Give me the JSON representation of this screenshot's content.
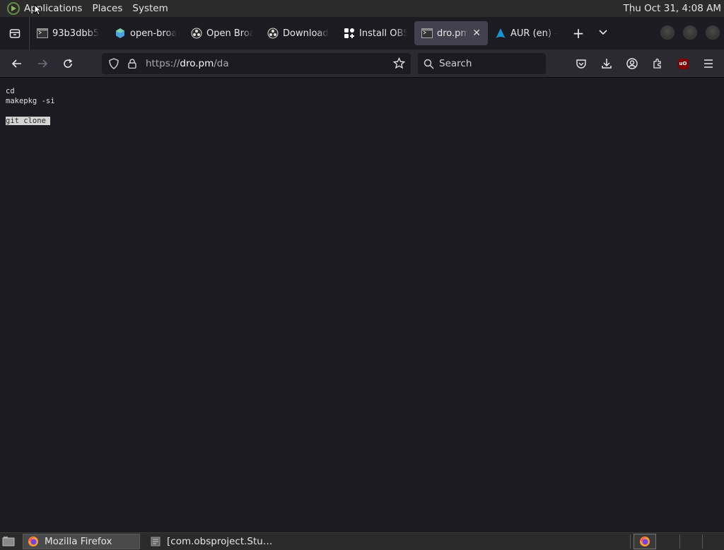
{
  "top_panel": {
    "menus": [
      "Applications",
      "Places",
      "System"
    ],
    "clock": "Thu Oct 31,  4:08 AM"
  },
  "tabs": [
    {
      "title": "93b3dbb5",
      "icon": "terminal-favicon",
      "active": false
    },
    {
      "title": "open-broa",
      "icon": "flathub-favicon",
      "active": false
    },
    {
      "title": "Open Broa",
      "icon": "obs-favicon",
      "active": false
    },
    {
      "title": "Download",
      "icon": "obs-favicon",
      "active": false
    },
    {
      "title": "Install OBS",
      "icon": "flathub-favicon",
      "active": false
    },
    {
      "title": "dro.pm/d",
      "icon": "terminal-favicon",
      "active": true
    },
    {
      "title": "AUR (en) -",
      "icon": "arch-favicon",
      "active": false
    }
  ],
  "navbar": {
    "url_protocol": "https://",
    "url_host": "dro.pm",
    "url_path": "/da",
    "search_placeholder": "Search"
  },
  "content": {
    "lines": [
      "cd",
      "makepkg -si",
      "",
      "git clone"
    ],
    "selected_line": "git clone"
  },
  "taskbar": {
    "items": [
      {
        "label": "Mozilla Firefox",
        "active": true
      },
      {
        "label": "[com.obsproject.Stu…",
        "active": false
      }
    ]
  },
  "colors": {
    "page_bg": "#1c1b22",
    "toolbar_bg": "#2b2a33",
    "active_tab": "#42414d",
    "panel_bg": "#2b2b2b"
  }
}
